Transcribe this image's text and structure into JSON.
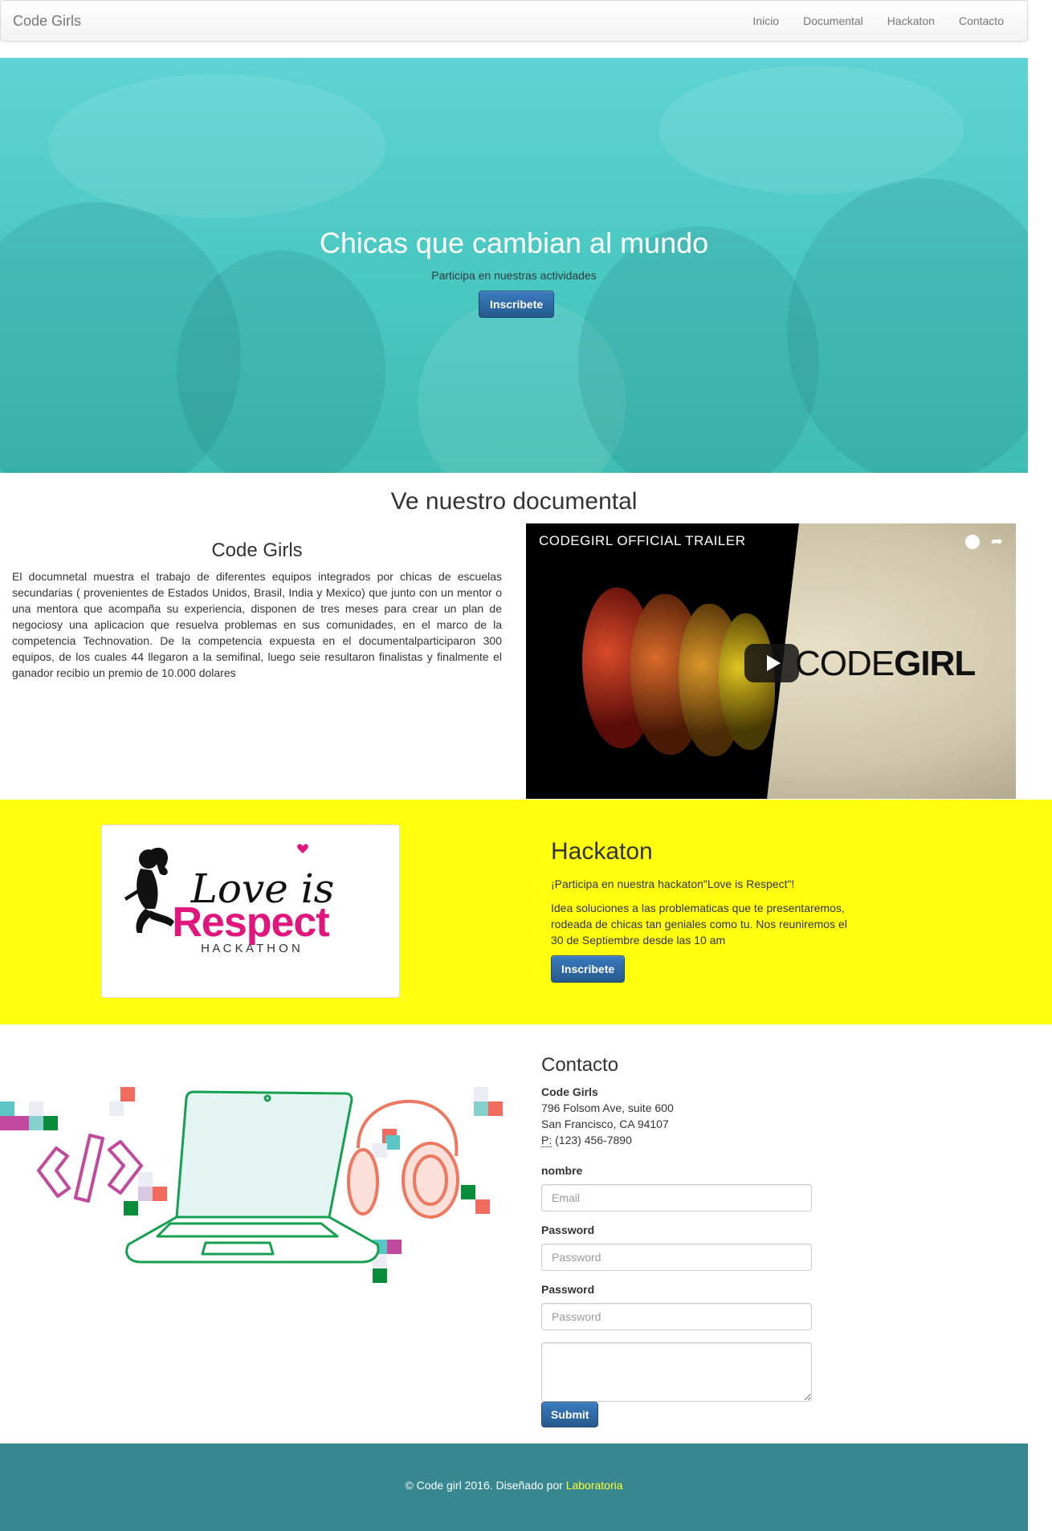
{
  "navbar": {
    "brand": "Code Girls",
    "links": [
      "Inicio",
      "Documental",
      "Hackaton",
      "Contacto"
    ]
  },
  "hero": {
    "title": "Chicas que cambian al mundo",
    "subtitle": "Participa en nuestras actividades",
    "button": "Inscribete"
  },
  "documental": {
    "heading": "Ve nuestro documental",
    "subheading": "Code Girls",
    "text": "El documnetal muestra el trabajo de diferentes equipos integrados por chicas de escuelas secundarias ( provenientes de Estados Unidos, Brasil, India y Mexico) que junto con un mentor o una mentora que acompaña su experiencia, disponen de tres meses para crear un plan de negociosy una aplicacion que resuelva problemas en sus comunidades, en el marco de la competencia Technovation. De la competencia expuesta en el documentalparticiparon 300 equipos, de los cuales 44 llegaron a la semifinal, luego seie resultaron finalistas y finalmente el ganador recibio un premio de 10.000 dolares",
    "video": {
      "title": "CODEGIRL OFFICIAL TRAILER",
      "brand_light": "CODE",
      "brand_bold": "GIRL"
    }
  },
  "hackaton": {
    "logo_text": {
      "script": "Love is",
      "bold": "Respect",
      "spaced": "H A C K A T H O N"
    },
    "title": "Hackaton",
    "intro": "¡Participa en nuestra hackaton\"Love is Respect\"!",
    "description": "Idea soluciones a las problematicas que te presentaremos, rodeada de chicas tan geniales como tu. Nos reuniremos el 30 de Septiembre desde las 10 am",
    "button": "Inscribete"
  },
  "contact": {
    "title": "Contacto",
    "org": "Code Girls",
    "address1": "796 Folsom Ave, suite 600",
    "address2": "San Francisco, CA 94107",
    "phone_label": "P:",
    "phone": " (123) 456-7890",
    "fields": [
      {
        "label": "nombre",
        "placeholder": "Email"
      },
      {
        "label": "Password",
        "placeholder": "Password"
      },
      {
        "label": "Password",
        "placeholder": "Password"
      }
    ],
    "submit": "Submit"
  },
  "footer": {
    "copy": "© Code girl 2016. Diseñado por ",
    "link": "Laboratoria"
  },
  "colors": {
    "hero_teal": "#49c7c1",
    "hack_yellow": "#ffff0f",
    "footer_teal": "#36878f",
    "button_blue": "#337ab7",
    "logo_pink": "#e0157e"
  }
}
